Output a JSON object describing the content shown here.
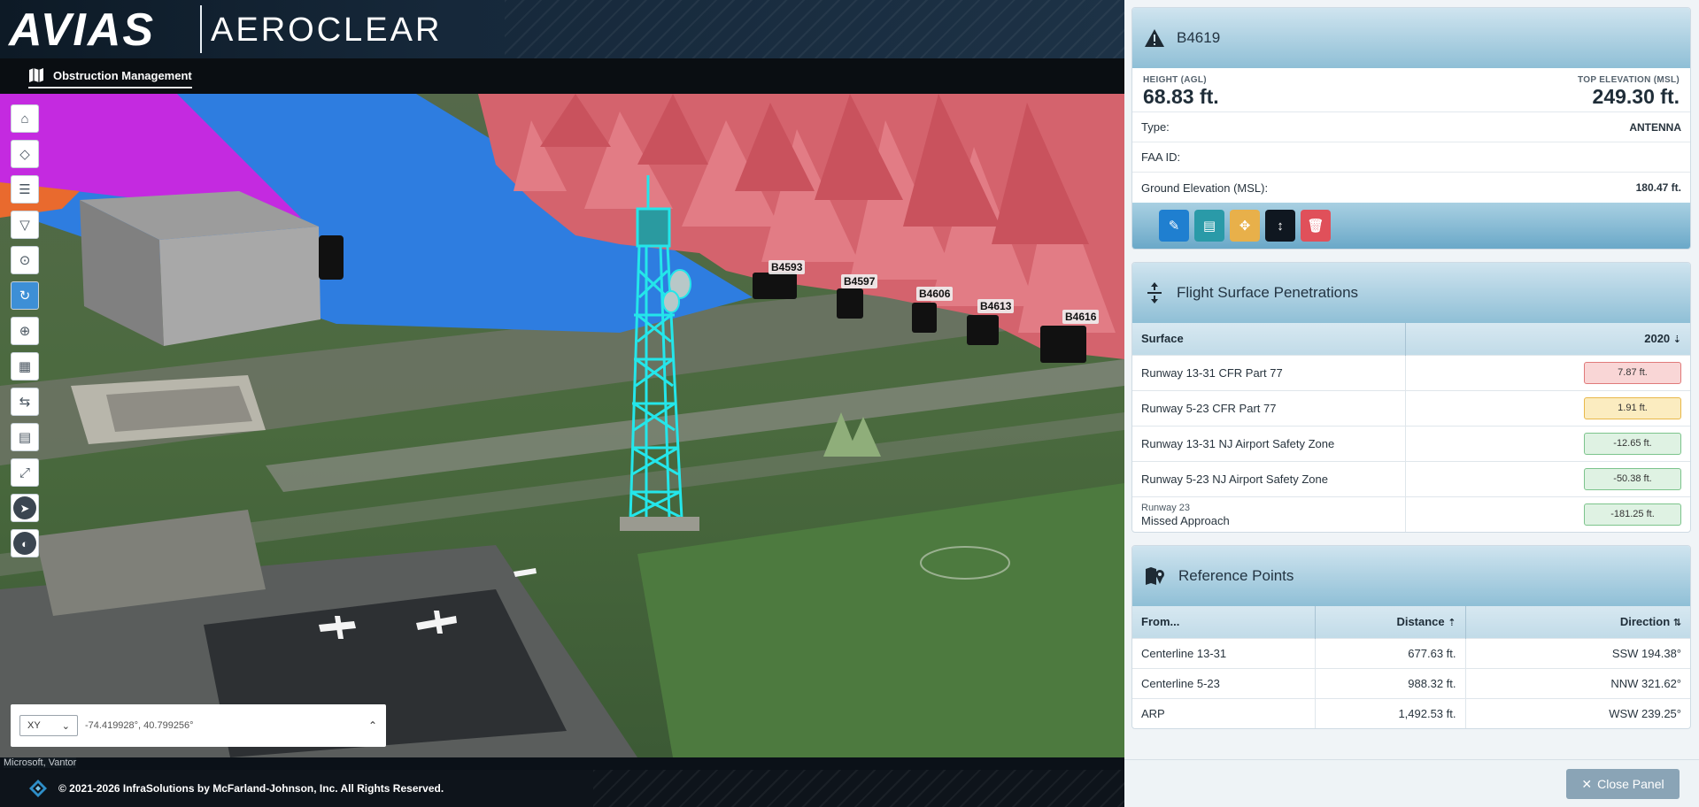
{
  "header": {
    "logo_text": "AVIAS",
    "logo_sub": "AEROCLEAR",
    "nav_tab": "Obstruction Management"
  },
  "map": {
    "labels": [
      "B4593",
      "B4597",
      "B4606",
      "B4613",
      "B4616"
    ],
    "toolbar_icons": [
      "home-icon",
      "layers-icon",
      "list-icon",
      "filter-icon",
      "zoom-search-icon",
      "refresh-icon",
      "add-location-icon",
      "qr-icon",
      "measure-icon",
      "document-icon",
      "fullscreen-icon",
      "compass-icon",
      "globe-icon"
    ],
    "coord": {
      "system": "XY",
      "value": "-74.419928°, 40.799256°"
    },
    "attribution": "Microsoft, Vantor"
  },
  "footer": {
    "copyright": "© 2021-2026 InfraSolutions by McFarland-Johnson, Inc. All Rights Reserved."
  },
  "obstruction": {
    "id": "B4619",
    "height_label": "HEIGHT (AGL)",
    "height_value": "68.83 ft.",
    "top_label": "TOP ELEVATION (MSL)",
    "top_value": "249.30 ft.",
    "rows": [
      {
        "label": "Type:",
        "value": "ANTENNA"
      },
      {
        "label": "FAA ID:",
        "value": ""
      },
      {
        "label": "Ground Elevation (MSL):",
        "value": "180.47 ft."
      }
    ],
    "actions": [
      {
        "icon": "edit-icon",
        "color": "#1f7fd0"
      },
      {
        "icon": "file-icon",
        "color": "#2a9aa8"
      },
      {
        "icon": "move-icon",
        "color": "#e8b04a"
      },
      {
        "icon": "height-icon",
        "color": "#0f1720"
      },
      {
        "icon": "delete-icon",
        "color": "#e0505a"
      }
    ]
  },
  "penetrations": {
    "title": "Flight Surface Penetrations",
    "col_surface": "Surface",
    "col_year": "2020",
    "rows": [
      {
        "surface": "Runway 13-31 CFR Part 77",
        "sub": "",
        "value": "7.87 ft.",
        "status": "red"
      },
      {
        "surface": "Runway 5-23 CFR Part 77",
        "sub": "",
        "value": "1.91 ft.",
        "status": "yellow"
      },
      {
        "surface": "Runway 13-31 NJ Airport Safety Zone",
        "sub": "",
        "value": "-12.65 ft.",
        "status": "green"
      },
      {
        "surface": "Runway 5-23 NJ Airport Safety Zone",
        "sub": "",
        "value": "-50.38 ft.",
        "status": "green"
      },
      {
        "surface": "Missed Approach",
        "sub": "Runway 23",
        "value": "-181.25 ft.",
        "status": "green"
      }
    ]
  },
  "reference": {
    "title": "Reference Points",
    "col_from": "From...",
    "col_distance": "Distance",
    "col_direction": "Direction",
    "rows": [
      {
        "from": "Centerline 13-31",
        "distance": "677.63 ft.",
        "direction": "SSW 194.38°"
      },
      {
        "from": "Centerline 5-23",
        "distance": "988.32 ft.",
        "direction": "NNW 321.62°"
      },
      {
        "from": "ARP",
        "distance": "1,492.53 ft.",
        "direction": "WSW 239.25°"
      }
    ]
  },
  "close_label": "Close Panel",
  "colors": {
    "red_bg": "#f9d6d6",
    "red_border": "#e07a7a",
    "yellow_bg": "#fbecc0",
    "yellow_border": "#e8b84a",
    "green_bg": "#dff2e3",
    "green_border": "#7cc48c"
  }
}
